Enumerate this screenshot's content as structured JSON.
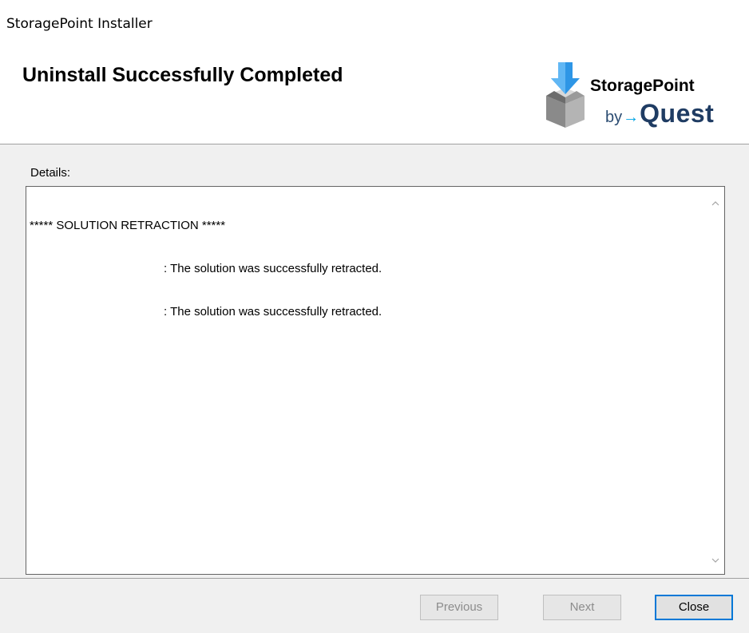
{
  "window": {
    "title": "StoragePoint Installer"
  },
  "header": {
    "heading": "Uninstall Successfully Completed",
    "logo": {
      "product": "StoragePoint",
      "by": "by",
      "company": "Quest"
    }
  },
  "details": {
    "label": "Details:",
    "lines": [
      "***** SOLUTION RETRACTION *****",
      ": The solution was successfully retracted.",
      ": The solution was successfully retracted."
    ]
  },
  "buttons": {
    "previous": "Previous",
    "next": "Next",
    "close": "Close"
  },
  "colors": {
    "accent": "#0078d7",
    "logo_blue": "#00a4e4",
    "logo_navy": "#1f3c63"
  },
  "icons": {
    "logo": "storagepoint-box-icon",
    "scroll_up": "chevron-up-icon",
    "scroll_down": "chevron-down-icon"
  }
}
